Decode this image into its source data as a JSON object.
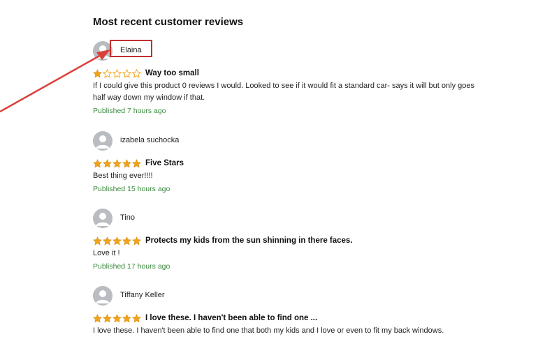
{
  "section_title": "Most recent customer reviews",
  "colors": {
    "star_filled": "#f0a41b",
    "star_empty_stroke": "#f0a41b",
    "published": "#3b8a3e",
    "highlight": "#c0302e",
    "avatar": "#b9bdc1"
  },
  "reviews": [
    {
      "author": "Elaina",
      "rating": 1,
      "title": "Way too small",
      "body": "If I could give this product 0 reviews I would. Looked to see if it would fit a standard car- says it will but only goes half way down my window if that.",
      "published": "Published 7 hours ago"
    },
    {
      "author": "izabela suchocka",
      "rating": 5,
      "title": "Five Stars",
      "body": "Best thing ever!!!!",
      "published": "Published 15 hours ago"
    },
    {
      "author": "Tino",
      "rating": 5,
      "title": "Protects my kids from the sun shinning in there faces.",
      "body": "Love it !",
      "published": "Published 17 hours ago"
    },
    {
      "author": "Tiffany Keller",
      "rating": 5,
      "title": "I love these. I haven't been able to find one ...",
      "body": "I love these. I haven't been able to find one that both my kids and I love or even to fit my back windows.",
      "published": ""
    }
  ]
}
